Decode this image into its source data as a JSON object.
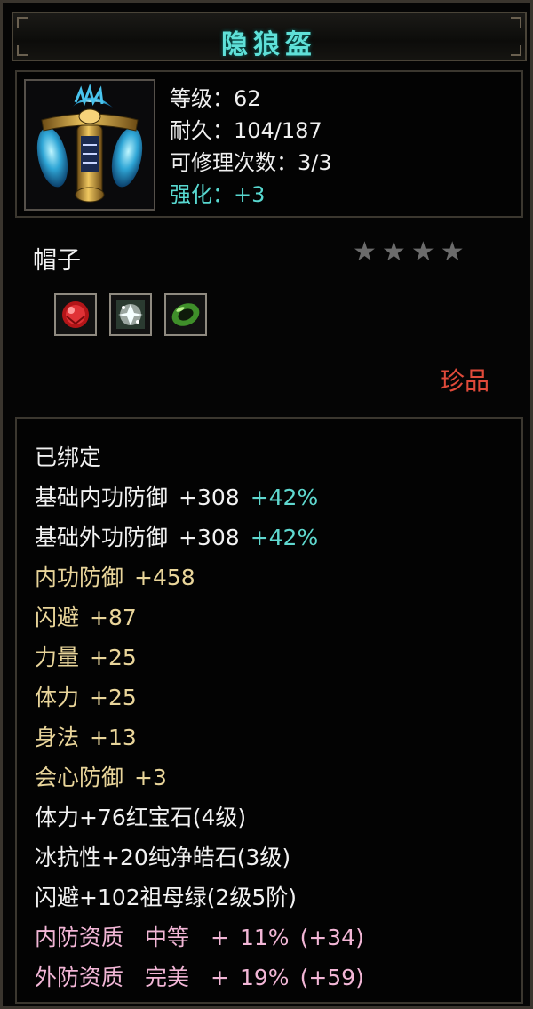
{
  "title": "隐狼盔",
  "stats": {
    "level": "等级：62",
    "durability": "耐久：104/187",
    "repair": "可修理次数：3/3",
    "enhance": "强化：+3"
  },
  "slot": "帽子",
  "stars": {
    "filled": 0,
    "total": 4
  },
  "gems": [
    {
      "icon": "red-gem-icon",
      "color": "#d8262a"
    },
    {
      "icon": "white-diamond-icon",
      "color": "#e8f2f2"
    },
    {
      "icon": "green-jade-ring-icon",
      "color": "#59b83a"
    }
  ],
  "rarity": "珍品",
  "colors": {
    "title": "#5fe0d8",
    "enhance": "#58d8d0",
    "rarity": "#e04a3a",
    "attr_gold": "#e9d59a",
    "attr_cyan": "#5fd8cf",
    "attr_pink": "#f2b6d6"
  },
  "attributes": {
    "bound": "已绑定",
    "base_inner_def": {
      "label": "基础内功防御",
      "value": "+308",
      "bonus": "+42%"
    },
    "base_outer_def": {
      "label": "基础外功防御",
      "value": "+308",
      "bonus": "+42%"
    },
    "inner_def": {
      "label": "内功防御",
      "value": "+458"
    },
    "dodge": {
      "label": "闪避",
      "value": "+87"
    },
    "strength": {
      "label": "力量",
      "value": "+25"
    },
    "stamina": {
      "label": "体力",
      "value": "+25"
    },
    "agility": {
      "label": "身法",
      "value": "+13"
    },
    "crit_def": {
      "label": "会心防御",
      "value": "+3"
    },
    "gem1": "体力+76红宝石(4级)",
    "gem2": "冰抗性+20纯净皓石(3级)",
    "gem3": "闪避+102祖母绿(2级5阶)",
    "quality_inner": {
      "label": "内防资质",
      "grade": "中等",
      "plus": "+",
      "pct": "11%",
      "extra": "(+34)"
    },
    "quality_outer": {
      "label": "外防资质",
      "grade": "完美",
      "plus": "+",
      "pct": "19%",
      "extra": "(+59)"
    }
  }
}
